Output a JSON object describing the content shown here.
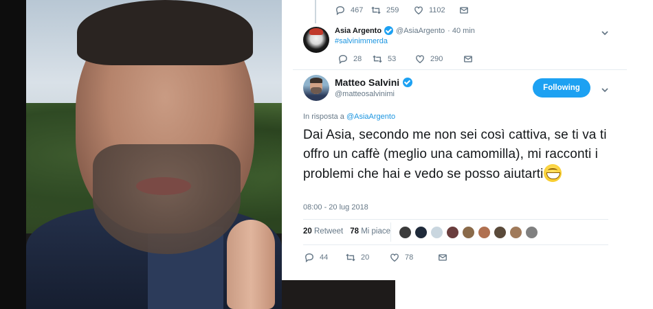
{
  "prev_tweet": {
    "reply_count": "467",
    "retweet_count": "259",
    "like_count": "1102"
  },
  "reply_tweet": {
    "name": "Asia Argento",
    "handle": "@AsiaArgento",
    "time": "· 40 min",
    "text": "#salvinimmerda",
    "reply_count": "28",
    "retweet_count": "53",
    "like_count": "290"
  },
  "main_tweet": {
    "name": "Matteo Salvini",
    "handle": "@matteosalvinimi",
    "follow_label": "Following",
    "reply_to_prefix": "In risposta a",
    "reply_to_handle": "@AsiaArgento",
    "text": "Dai Asia, secondo me non sei così cattiva, se ti va ti offro un caffè (meglio una camomilla), mi racconti i problemi che hai e vedo se posso aiutarti",
    "timestamp": "08:00 - 20 lug 2018",
    "retweets_num": "20",
    "retweets_label": "Retweet",
    "likes_num": "78",
    "likes_label": "Mi piace",
    "reply_count": "44",
    "retweet_count": "20",
    "like_count": "78"
  },
  "icons": {
    "reply": "reply-icon",
    "retweet": "retweet-icon",
    "like": "heart-icon",
    "message": "envelope-icon",
    "verified": "verified-badge-icon",
    "chevron": "chevron-down-icon",
    "emoji": "grinning-face-icon"
  },
  "colors": {
    "accent": "#1da1f2",
    "link": "#1b95e0",
    "muted": "#657786",
    "text": "#14171a"
  },
  "likers_colors": [
    "#3b3b3b",
    "#1f2a3a",
    "#c9d6df",
    "#6a3d3d",
    "#8a6a4a",
    "#b07050",
    "#5a4a3a",
    "#a07a5a",
    "#808080"
  ]
}
